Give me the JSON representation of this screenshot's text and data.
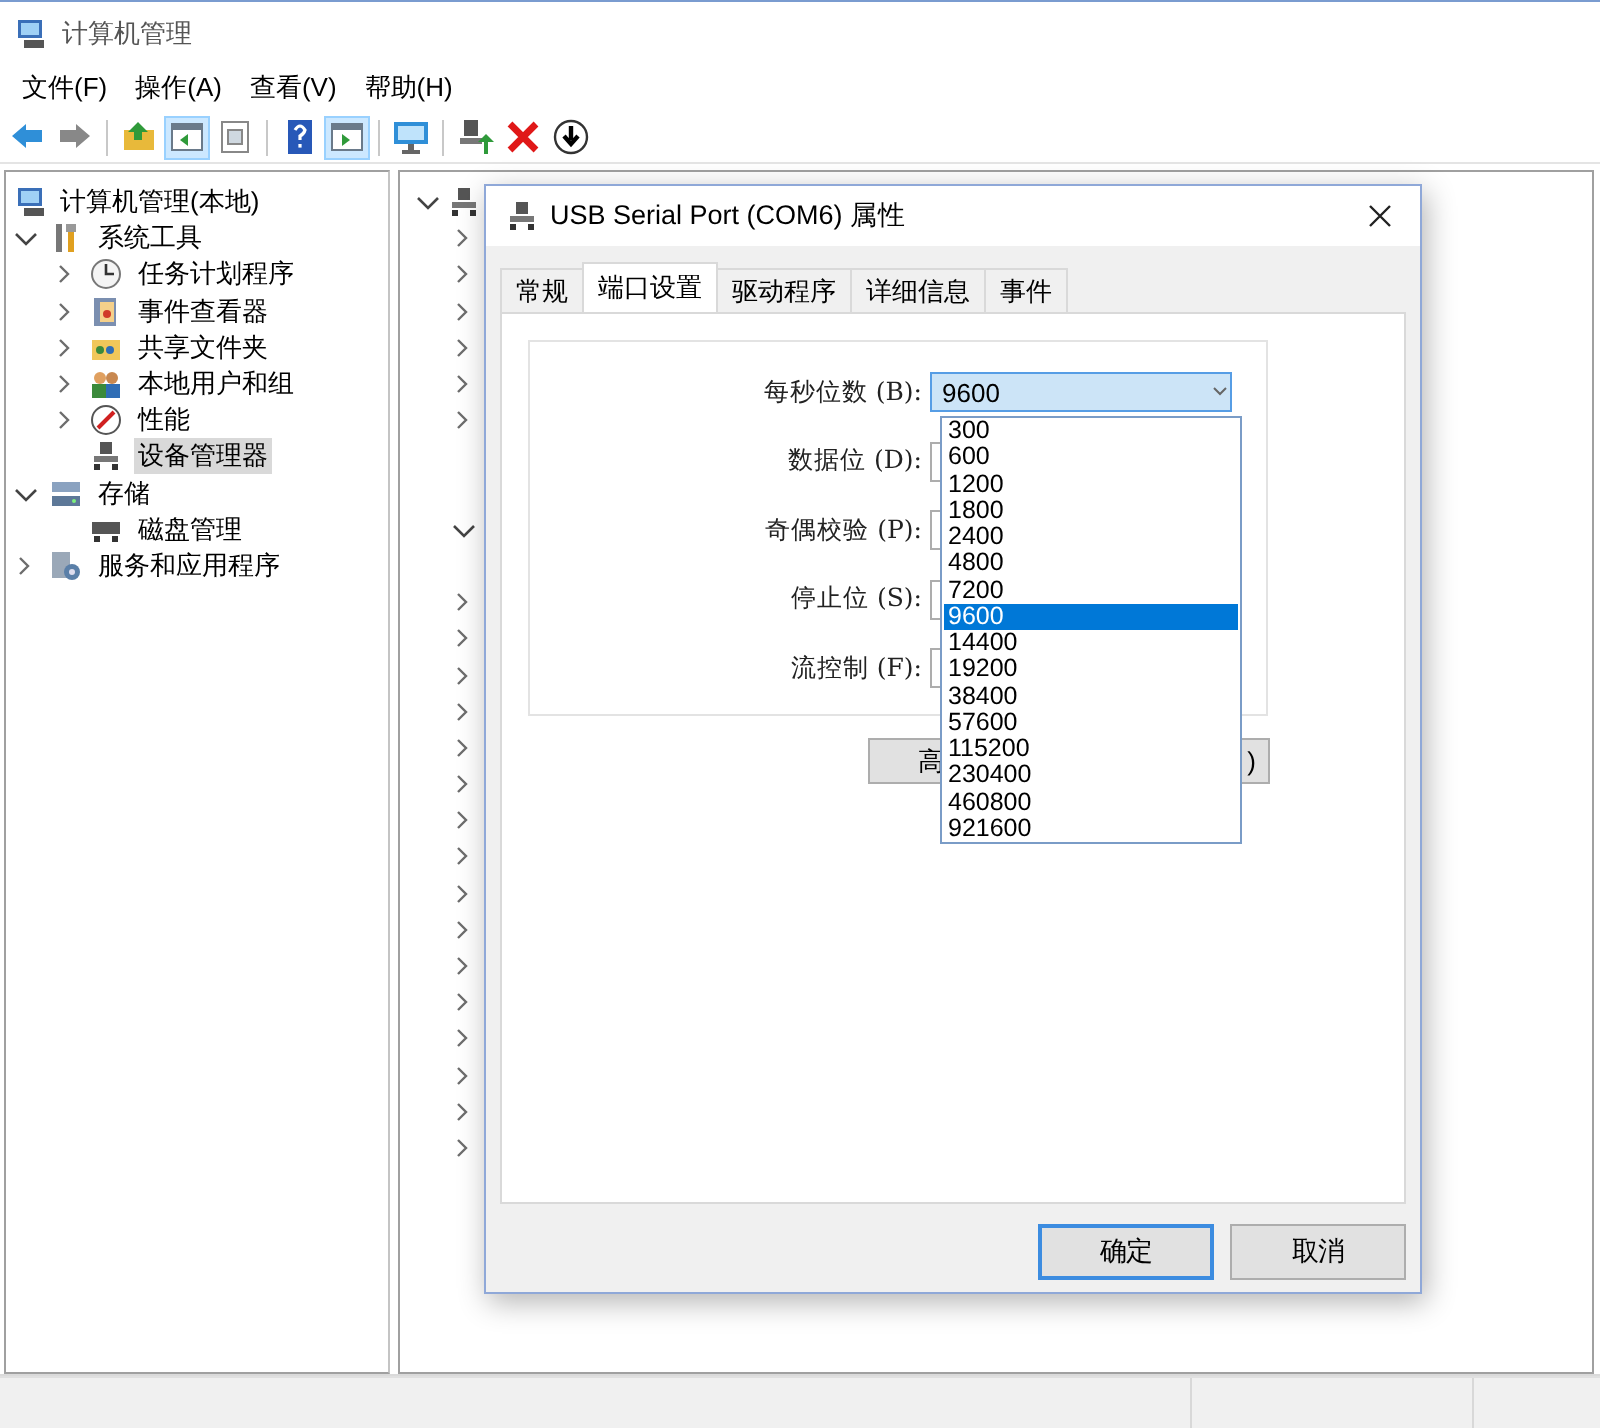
{
  "window": {
    "title": "计算机管理"
  },
  "menu": [
    "文件(F)",
    "操作(A)",
    "查看(V)",
    "帮助(H)"
  ],
  "toolbar": [
    {
      "kind": "back",
      "pressed": false
    },
    {
      "kind": "forward",
      "pressed": false
    },
    {
      "kind": "separator"
    },
    {
      "kind": "up",
      "pressed": false
    },
    {
      "kind": "tree",
      "pressed": true
    },
    {
      "kind": "export",
      "pressed": false
    },
    {
      "kind": "separator"
    },
    {
      "kind": "help",
      "pressed": false
    },
    {
      "kind": "pane",
      "pressed": true
    },
    {
      "kind": "separator"
    },
    {
      "kind": "scan",
      "pressed": false
    },
    {
      "kind": "separator"
    },
    {
      "kind": "enable",
      "pressed": false
    },
    {
      "kind": "uninstall",
      "pressed": false
    },
    {
      "kind": "disable",
      "pressed": false
    }
  ],
  "nav_tree": {
    "root": {
      "label": "计算机管理(本地)",
      "selected": false
    },
    "items": [
      {
        "label": "系统工具",
        "kind": "tools",
        "expanded": true,
        "selected": false,
        "children": [
          {
            "label": "任务计划程序",
            "kind": "clock",
            "expanded": false,
            "selected": false
          },
          {
            "label": "事件查看器",
            "kind": "log",
            "expanded": false,
            "selected": false
          },
          {
            "label": "共享文件夹",
            "kind": "share",
            "expanded": false,
            "selected": false
          },
          {
            "label": "本地用户和组",
            "kind": "users",
            "expanded": false,
            "selected": false
          },
          {
            "label": "性能",
            "kind": "gauge",
            "expanded": false,
            "selected": false
          },
          {
            "label": "设备管理器",
            "kind": "device",
            "selected": true
          }
        ]
      },
      {
        "label": "存储",
        "kind": "storage",
        "expanded": true,
        "selected": false,
        "children": [
          {
            "label": "磁盘管理",
            "kind": "disk",
            "selected": false
          }
        ]
      },
      {
        "label": "服务和应用程序",
        "kind": "services",
        "expanded": false,
        "selected": false
      }
    ]
  },
  "device_tree": {
    "root": {
      "expanded": true
    },
    "rows": [
      {
        "kind": "category",
        "expanded": false
      },
      {
        "kind": "category",
        "expanded": false
      },
      {
        "kind": "category",
        "expanded": false
      },
      {
        "kind": "category",
        "expanded": false
      },
      {
        "kind": "category",
        "expanded": false
      },
      {
        "kind": "category",
        "expanded": false
      },
      {
        "kind": "device"
      },
      {
        "kind": "device"
      },
      {
        "kind": "category",
        "expanded": true
      },
      {
        "kind": "device"
      },
      {
        "kind": "category",
        "expanded": false
      },
      {
        "kind": "category",
        "expanded": false
      },
      {
        "kind": "category",
        "expanded": false
      },
      {
        "kind": "category",
        "expanded": false
      },
      {
        "kind": "category",
        "expanded": false
      },
      {
        "kind": "category",
        "expanded": false
      },
      {
        "kind": "category",
        "expanded": false
      },
      {
        "kind": "category",
        "expanded": false
      },
      {
        "kind": "category",
        "expanded": false
      },
      {
        "kind": "category",
        "expanded": false
      },
      {
        "kind": "category",
        "expanded": false
      },
      {
        "kind": "category",
        "expanded": false
      },
      {
        "kind": "category",
        "expanded": false
      },
      {
        "kind": "category",
        "expanded": false
      },
      {
        "kind": "category",
        "expanded": false
      },
      {
        "kind": "category",
        "expanded": false
      }
    ]
  },
  "dialog": {
    "title": "USB Serial Port (COM6) 属性",
    "tabs": [
      {
        "label": "常规",
        "selected": false
      },
      {
        "label": "端口设置",
        "selected": true
      },
      {
        "label": "驱动程序",
        "selected": false
      },
      {
        "label": "详细信息",
        "selected": false
      },
      {
        "label": "事件",
        "selected": false
      }
    ],
    "fields": [
      {
        "label": "每秒位数 (B):",
        "value": "9600",
        "open": true,
        "options": [
          {
            "label": "300",
            "selected": false
          },
          {
            "label": "600",
            "selected": false
          },
          {
            "label": "1200",
            "selected": false
          },
          {
            "label": "1800",
            "selected": false
          },
          {
            "label": "2400",
            "selected": false
          },
          {
            "label": "4800",
            "selected": false
          },
          {
            "label": "7200",
            "selected": false
          },
          {
            "label": "9600",
            "selected": true
          },
          {
            "label": "14400",
            "selected": false
          },
          {
            "label": "19200",
            "selected": false
          },
          {
            "label": "38400",
            "selected": false
          },
          {
            "label": "57600",
            "selected": false
          },
          {
            "label": "115200",
            "selected": false
          },
          {
            "label": "230400",
            "selected": false
          },
          {
            "label": "460800",
            "selected": false
          },
          {
            "label": "921600",
            "selected": false
          }
        ]
      },
      {
        "label": "数据位 (D):",
        "open": false
      },
      {
        "label": "奇偶校验 (P):",
        "open": false
      },
      {
        "label": "停止位 (S):",
        "open": false
      },
      {
        "label": "流控制 (F):",
        "open": false
      }
    ],
    "advanced_button": "高",
    "restore_button": ")",
    "ok_button": "确定",
    "cancel_button": "取消"
  }
}
